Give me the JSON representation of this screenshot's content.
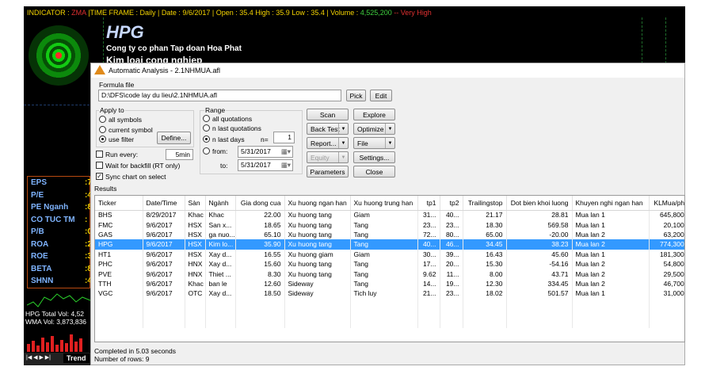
{
  "chart": {
    "indicator_label": "INDICATOR : ",
    "indicator_value": "ZMA",
    "timeframe": " |TIME FRAME : Daily  |  Date : 9/6/2017  |  Open : 35.4   High : 35.9   Low : 35.4  |  Volume : ",
    "volume": "4,525,200",
    "volume_suffix": " -- Very High",
    "ticker": "HPG",
    "company_name": "Cong ty co phan Tap doan Hoa Phat",
    "sector": "Kim loai cong nghiep",
    "fundamentals": [
      {
        "label": "EPS",
        "value": ":7"
      },
      {
        "label": "P/E",
        "value": ":4"
      },
      {
        "label": "PE Nganh",
        "value": ":8"
      },
      {
        "label": "CO TUC TM",
        "value": ":"
      },
      {
        "label": "P/B",
        "value": ":0"
      },
      {
        "label": "ROA",
        "value": ":2"
      },
      {
        "label": "ROE",
        "value": ":3"
      },
      {
        "label": "BETA",
        "value": ":8"
      },
      {
        "label": "SHNN",
        "value": ":4"
      }
    ],
    "vol_line1": "HPG  Total Vol: 4,52",
    "vol_line2": "WMA Vol: 3,873,836",
    "tab_label": "Trend",
    "nav_arrows": "|◀ ◀ ▶ ▶|"
  },
  "dialog": {
    "title": "Automatic Analysis - 2.1NHMUA.afl",
    "formula_file_label": "Formula file",
    "formula_path": "D:\\DFS\\code lay du lieu\\2.1NHMUA.afl",
    "pick": "Pick",
    "edit": "Edit",
    "apply_to_label": "Apply to",
    "apply_all": "all symbols",
    "apply_current": "current symbol",
    "apply_filter": "use filter",
    "define": "Define...",
    "range_label": "Range",
    "range_all": "all quotations",
    "range_n_last_quotations": "n last quotations",
    "range_n_last_days": "n last days",
    "n_label": "n=",
    "n_value": "1",
    "from_label": "from:",
    "from_value": "5/31/2017",
    "to_label": "to:",
    "to_value": "5/31/2017",
    "run_every": "Run every:",
    "run_every_value": "5min",
    "wait_backfill": "Wait for backfill (RT only)",
    "sync_chart": "Sync chart on select",
    "scan": "Scan",
    "explore": "Explore",
    "back_test": "Back Test",
    "optimize": "Optimize",
    "report": "Report...",
    "file": "File",
    "equity": "Equity",
    "settings": "Settings...",
    "parameters": "Parameters",
    "close": "Close",
    "results_label": "Results",
    "columns": [
      "Ticker",
      "Date/Time",
      "Sàn",
      "Ngành",
      "Gia dong cua",
      "Xu huong ngan han",
      "Xu huong trung han",
      "tp1",
      "tp2",
      "Trailingstop",
      "Dot bien khoi luong",
      "Khuyen nghi ngan han",
      "KLMua/phien"
    ],
    "rows": [
      [
        "BHS",
        "8/29/2017",
        "Khac",
        "Khac",
        "22.00",
        "Xu huong tang",
        "Giam",
        "31...",
        "40...",
        "21.17",
        "28.81",
        "Mua lan 1",
        "645,800.00"
      ],
      [
        "FMC",
        "9/6/2017",
        "HSX",
        "San x...",
        "18.65",
        "Xu huong tang",
        "Tang",
        "23...",
        "23...",
        "18.30",
        "569.58",
        "Mua lan 1",
        "20,100.00"
      ],
      [
        "GAS",
        "9/6/2017",
        "HSX",
        "ga nuo...",
        "65.10",
        "Xu huong tang",
        "Tang",
        "72...",
        "80...",
        "65.00",
        "-20.00",
        "Mua lan 2",
        "63,200.00"
      ],
      [
        "HPG",
        "9/6/2017",
        "HSX",
        "Kim lo...",
        "35.90",
        "Xu huong tang",
        "Tang",
        "40...",
        "46...",
        "34.45",
        "38.23",
        "Mua lan 2",
        "774,300.00"
      ],
      [
        "HT1",
        "9/6/2017",
        "HSX",
        "Xay d...",
        "16.55",
        "Xu huong giam",
        "Giam",
        "30...",
        "39...",
        "16.43",
        "45.60",
        "Mua lan 1",
        "181,300.00"
      ],
      [
        "PHC",
        "9/6/2017",
        "HNX",
        "Xay d...",
        "15.60",
        "Xu huong tang",
        "Tang",
        "17...",
        "20...",
        "15.30",
        "-54.16",
        "Mua lan 2",
        "54,800.00"
      ],
      [
        "PVE",
        "9/6/2017",
        "HNX",
        "Thiet ...",
        "8.30",
        "Xu huong tang",
        "Tang",
        "9.62",
        "11...",
        "8.00",
        "43.71",
        "Mua lan 2",
        "29,500.00"
      ],
      [
        "TTH",
        "9/6/2017",
        "Khac",
        "ban le",
        "12.60",
        "Sideway",
        "Tang",
        "14...",
        "19...",
        "12.30",
        "334.45",
        "Mua lan 2",
        "46,700.00"
      ],
      [
        "VGC",
        "9/6/2017",
        "OTC",
        "Xay d...",
        "18.50",
        "Sideway",
        "Tich luy",
        "21...",
        "23...",
        "18.02",
        "501.57",
        "Mua lan 1",
        "31,000.00"
      ]
    ],
    "status_line1": "Completed in 5.03 seconds",
    "status_line2": "Number of rows: 9"
  }
}
